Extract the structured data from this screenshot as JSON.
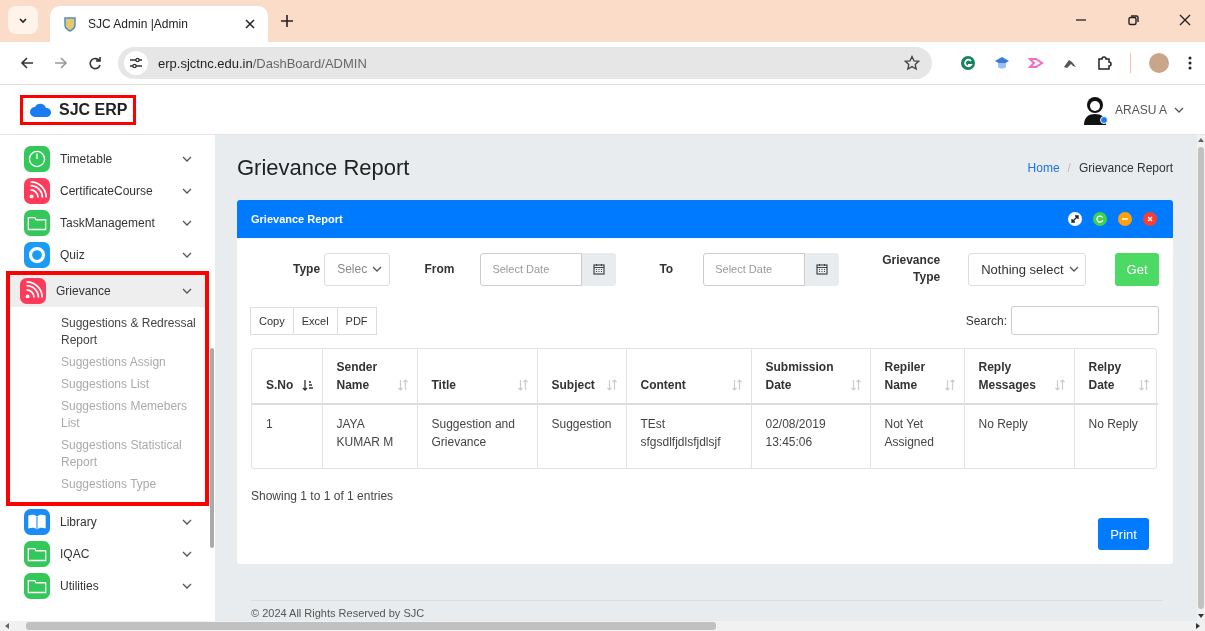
{
  "browser": {
    "tab_title": "SJC Admin |Admin",
    "url_host": "erp.sjctnc.edu.in",
    "url_path": "/DashBoard/ADMIN"
  },
  "header": {
    "brand": "SJC ERP",
    "brand_highlighted": true,
    "user": "ARASU A"
  },
  "sidebar": {
    "items": [
      {
        "label": "Timetable",
        "kind": "clock",
        "expanded": false,
        "highlighted": false
      },
      {
        "label": "CertificateCourse",
        "kind": "feed",
        "expanded": false,
        "highlighted": false
      },
      {
        "label": "TaskManagement",
        "kind": "folder",
        "expanded": false,
        "highlighted": false
      },
      {
        "label": "Quiz",
        "kind": "ring",
        "expanded": false,
        "highlighted": false
      },
      {
        "label": "Grievance",
        "kind": "feed",
        "expanded": true,
        "highlighted": true,
        "children": [
          {
            "label": "Suggestions & Redressal Report",
            "selected": true
          },
          {
            "label": "Suggestions Assign",
            "selected": false
          },
          {
            "label": "Suggestions List",
            "selected": false
          },
          {
            "label": "Suggestions Memebers List",
            "selected": false
          },
          {
            "label": "Suggestions Statistical Report",
            "selected": false
          },
          {
            "label": "Suggestions Type",
            "selected": false
          }
        ]
      },
      {
        "label": "Library",
        "kind": "book",
        "expanded": false,
        "highlighted": false
      },
      {
        "label": "IQAC",
        "kind": "folder",
        "expanded": false,
        "highlighted": false
      },
      {
        "label": "Utilities",
        "kind": "folder",
        "expanded": false,
        "highlighted": false
      }
    ]
  },
  "page": {
    "title": "Grievance Report",
    "breadcrumb": [
      "Home",
      "Grievance Report"
    ],
    "breadcrumb_separator": "/"
  },
  "card": {
    "title": "Grievance Report",
    "filters": {
      "type_label": "Type",
      "type_value": "Selec",
      "from_label": "From",
      "from_placeholder": "Select Date",
      "to_label": "To",
      "to_placeholder": "Select Date",
      "grievance_type_label": "Grievance Type",
      "grievance_type_value": "Nothing select",
      "get_button": "Get"
    },
    "export_buttons": [
      "Copy",
      "Excel",
      "PDF"
    ],
    "search_label": "Search:",
    "table": {
      "columns": [
        {
          "label": "S.No",
          "sorted": true
        },
        {
          "label": "Sender Name",
          "sorted": false
        },
        {
          "label": "Title",
          "sorted": false
        },
        {
          "label": "Subject",
          "sorted": false
        },
        {
          "label": "Content",
          "sorted": false
        },
        {
          "label": "Submission Date",
          "sorted": false
        },
        {
          "label": "Repiler Name",
          "sorted": false
        },
        {
          "label": "Reply Messages",
          "sorted": false
        },
        {
          "label": "Relpy Date",
          "sorted": false
        }
      ],
      "rows": [
        [
          "1",
          "JAYA KUMAR M",
          "Suggestion and Grievance",
          "Suggestion",
          "TEst sfgsdlfjdlsfjdlsjf",
          "02/08/2019 13:45:06",
          "Not Yet Assigned",
          "No Reply",
          "No Reply"
        ]
      ]
    },
    "info": "Showing 1 to 1 of 1 entries",
    "print_button": "Print"
  },
  "footer": "© 2024 All Rights Reserved by SJC"
}
